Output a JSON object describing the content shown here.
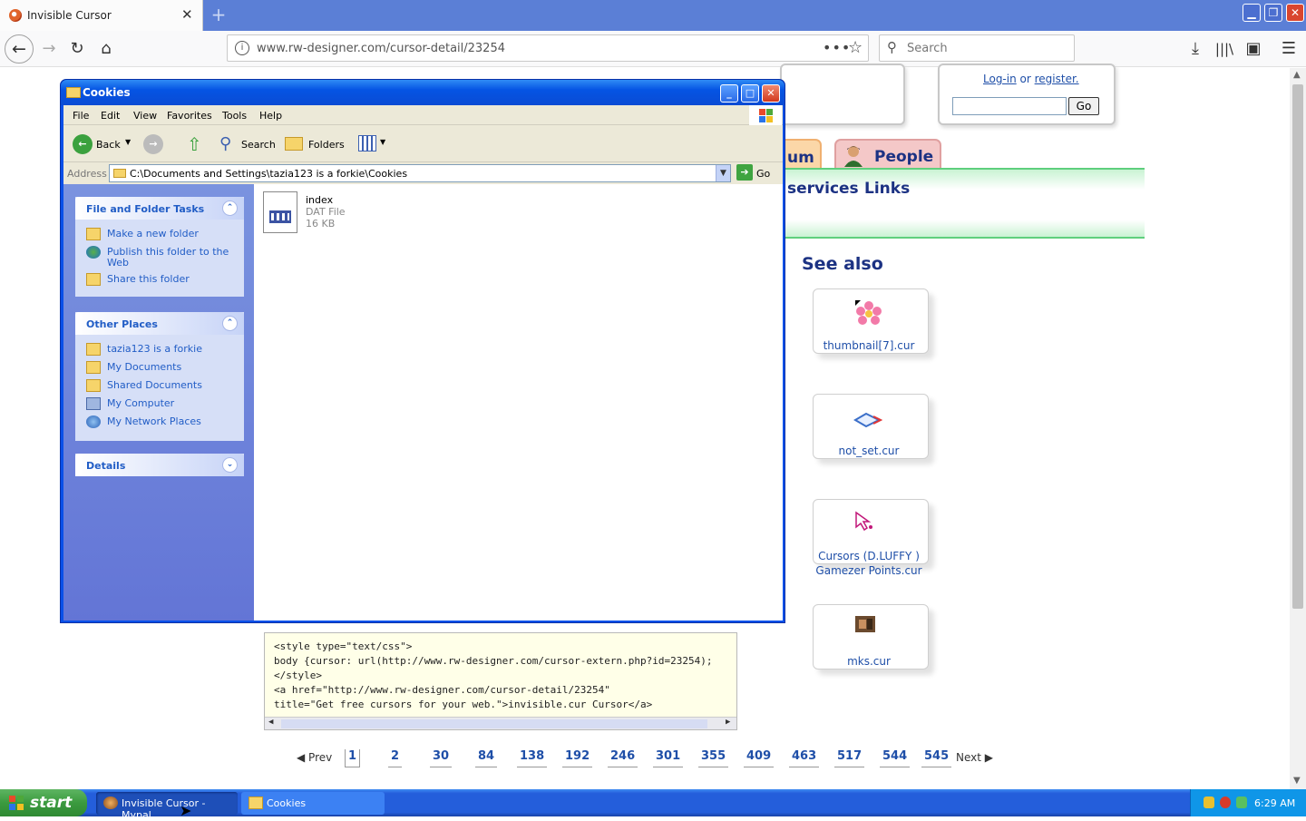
{
  "browser": {
    "tab_title": "Invisible Cursor",
    "url": "www.rw-designer.com/cursor-detail/23254",
    "search_placeholder": "Search"
  },
  "webpage": {
    "login_link": "Log-in",
    "login_or": " or ",
    "login_register": "register.",
    "go_button": "Go",
    "tab_forum": "um",
    "tab_people": "People",
    "link_services": "services",
    "link_links": "Links",
    "see_also": "See also",
    "cursors": [
      {
        "label_1": "thumbnail[7].cur",
        "label_2": ""
      },
      {
        "label_1": "not_set.cur",
        "label_2": ""
      },
      {
        "label_1": "Cursors (D.LUFFY )",
        "label_2": "Gamezer Points.cur"
      },
      {
        "label_1": "mks.cur",
        "label_2": ""
      }
    ],
    "code_lines": [
      "<style type=\"text/css\">",
      "body {cursor: url(http://www.rw-designer.com/cursor-extern.php?id=23254);",
      "</style>",
      "<a href=\"http://www.rw-designer.com/cursor-detail/23254\"",
      "title=\"Get free cursors for your web.\">invisible.cur Cursor</a>"
    ],
    "pager": {
      "prev": "Prev",
      "next": "Next",
      "pages": [
        "1",
        "2",
        "30",
        "84",
        "138",
        "192",
        "246",
        "301",
        "355",
        "409",
        "463",
        "517",
        "544",
        "545"
      ]
    }
  },
  "explorer": {
    "title": "Cookies",
    "menu": [
      "File",
      "Edit",
      "View",
      "Favorites",
      "Tools",
      "Help"
    ],
    "toolbar": {
      "back": "Back",
      "search": "Search",
      "folders": "Folders"
    },
    "address_label": "Address",
    "address_value": "C:\\Documents and Settings\\tazia123 is a forkie\\Cookies",
    "go_label": "Go",
    "file_tasks": {
      "header": "File and Folder Tasks",
      "items": [
        "Make a new folder",
        "Publish this folder to the",
        "Web",
        "Share this folder"
      ]
    },
    "other_places": {
      "header": "Other Places",
      "items": [
        "tazia123 is a forkie",
        "My Documents",
        "Shared Documents",
        "My Computer",
        "My Network Places"
      ]
    },
    "details_header": "Details",
    "file": {
      "name": "index",
      "type": "DAT File",
      "size": "16 KB"
    }
  },
  "taskbar": {
    "start": "start",
    "tasks": [
      "Invisible Cursor - Mypal",
      "Cookies"
    ],
    "clock": "6:29 AM"
  }
}
